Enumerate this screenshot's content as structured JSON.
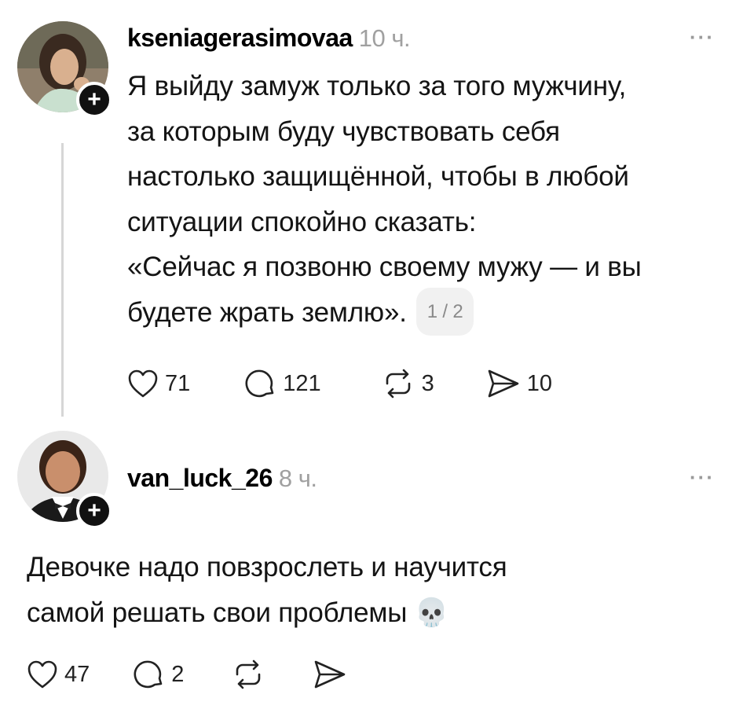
{
  "post1": {
    "username": "kseniagerasimovaa",
    "time": "10 ч.",
    "more_icon": "more-horizontal-icon",
    "lines": [
      "Я выйду замуж только за того мужчину,",
      "за которым буду чувствовать себя",
      "настолько защищённой, чтобы в любой",
      "ситуации спокойно сказать:",
      "«Сейчас я позвоню своему мужу — и вы"
    ],
    "last_line": "будете жрать землю».",
    "pager": "1 / 2",
    "likes": "71",
    "replies": "121",
    "reposts": "3",
    "shares": "10"
  },
  "post2": {
    "username": "van_luck_26",
    "time": "8 ч.",
    "lines": [
      "Девочке надо повзрослеть и научится",
      "самой решать свои проблемы"
    ],
    "emoji": "💀",
    "likes": "47",
    "replies": "2"
  },
  "colors": {
    "text": "#141414",
    "muted": "#a0a0a0",
    "line": "#d6d6d6"
  }
}
